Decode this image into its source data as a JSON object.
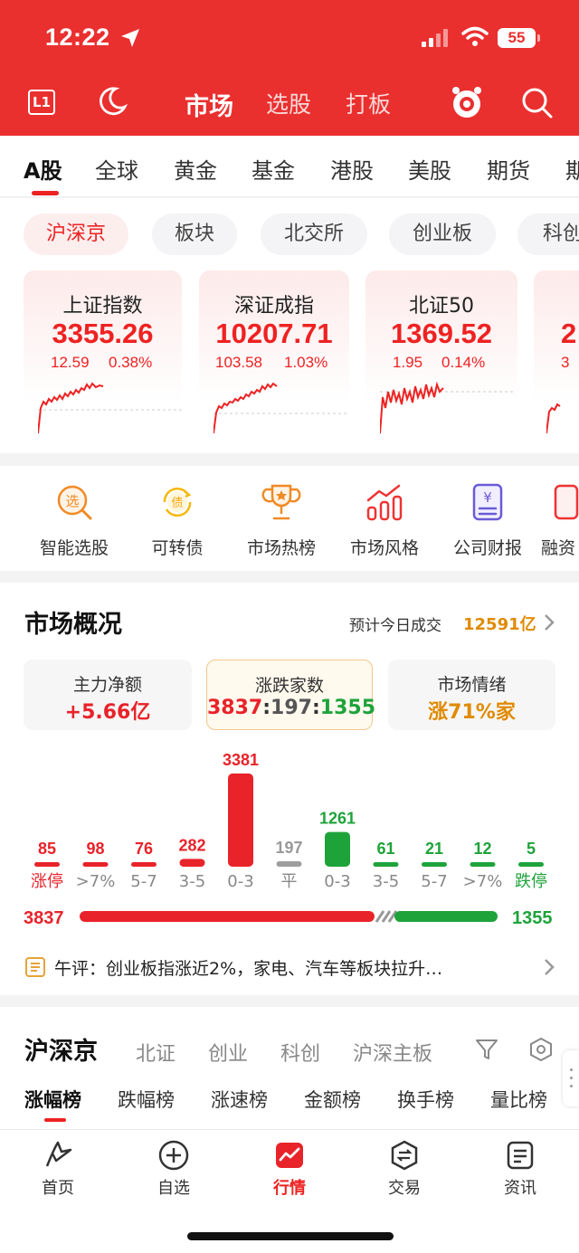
{
  "status": {
    "time": "12:22",
    "battery": "55"
  },
  "header": {
    "l1_label": "L1",
    "tabs": [
      "市场",
      "选股",
      "打板"
    ]
  },
  "market_tabs": [
    "A股",
    "全球",
    "黄金",
    "基金",
    "港股",
    "美股",
    "期货",
    "期"
  ],
  "exchange_chips": [
    "沪深京",
    "板块",
    "北交所",
    "创业板",
    "科创"
  ],
  "indices": [
    {
      "name": "上证指数",
      "value": "3355.26",
      "change": "12.59",
      "pct": "0.38%"
    },
    {
      "name": "深证成指",
      "value": "10207.71",
      "change": "103.58",
      "pct": "1.03%"
    },
    {
      "name": "北证50",
      "value": "1369.52",
      "change": "1.95",
      "pct": "0.14%"
    },
    {
      "name": "",
      "value": "2",
      "change": "3",
      "pct": ""
    }
  ],
  "tools": [
    "智能选股",
    "可转债",
    "市场热榜",
    "市场风格",
    "公司财报",
    "融资"
  ],
  "overview": {
    "title": "市场概况",
    "turnover_label": "预计今日成交",
    "turnover_value": "12591亿",
    "stats": [
      {
        "label": "主力净额",
        "value": "+5.66亿"
      },
      {
        "label": "涨跌家数",
        "up": "3837",
        "flat": "197",
        "down": "1355",
        "sep": ":"
      },
      {
        "label": "市场情绪",
        "value": "涨71%家"
      }
    ],
    "colors": {
      "up": "#e8232a",
      "down": "#1ea33a",
      "flat": "#999999",
      "accent": "#e08a00"
    }
  },
  "distribution": [
    {
      "label": "涨停",
      "count": "85",
      "dir": "up"
    },
    {
      "label": ">7%",
      "count": "98",
      "dir": "up"
    },
    {
      "label": "5-7",
      "count": "76",
      "dir": "up"
    },
    {
      "label": "3-5",
      "count": "282",
      "dir": "up"
    },
    {
      "label": "0-3",
      "count": "3381",
      "dir": "up"
    },
    {
      "label": "平",
      "count": "197",
      "dir": "flat"
    },
    {
      "label": "0-3",
      "count": "1261",
      "dir": "down"
    },
    {
      "label": "3-5",
      "count": "61",
      "dir": "down"
    },
    {
      "label": "5-7",
      "count": "21",
      "dir": "down"
    },
    {
      "label": ">7%",
      "count": "12",
      "dir": "down"
    },
    {
      "label": "跌停",
      "count": "5",
      "dir": "down"
    }
  ],
  "updown_totals": {
    "up": "3837",
    "down": "1355"
  },
  "news": "午评：创业板指涨近2%，家电、汽车等板块拉升…",
  "exchange_section": {
    "title": "沪深京",
    "tabs": [
      "北证",
      "创业",
      "科创",
      "沪深主板"
    ],
    "rank_tabs": [
      "涨幅榜",
      "跌幅榜",
      "涨速榜",
      "金额榜",
      "换手榜",
      "量比榜"
    ]
  },
  "tabbar": [
    "首页",
    "自选",
    "行情",
    "交易",
    "资讯"
  ]
}
